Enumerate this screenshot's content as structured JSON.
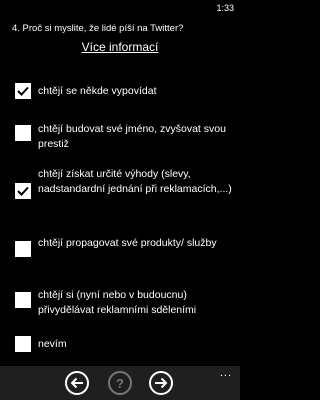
{
  "status": {
    "time": "1:33"
  },
  "question": {
    "text": "4.  Proč si myslite, že lidé píší na Twitter?",
    "more_info": "Více informací"
  },
  "options": [
    {
      "label": "chtějí se někde vypovídat",
      "checked": true
    },
    {
      "label": "chtějí budovat své jméno, zvyšovat svou prestiž",
      "checked": false
    },
    {
      "label": "chtějí získat určité výhody (slevy, nadstandardní jednání při reklamacích,...)",
      "checked": true
    },
    {
      "label": "chtějí propagovat své produkty/ služby",
      "checked": false
    },
    {
      "label": "chtějí si (nyní nebo v budoucnu) přivydělávat reklamními sděleními",
      "checked": false
    },
    {
      "label": "nevím",
      "checked": false
    }
  ],
  "app_bar": {
    "back_icon": "arrow-left-icon",
    "help_icon": "question-icon",
    "help_glyph": "?",
    "help_enabled": false,
    "forward_icon": "arrow-right-icon",
    "more_label": "..."
  },
  "colors": {
    "background": "#000000",
    "foreground": "#ffffff",
    "checkbox_fill": "#ffffff",
    "check_mark": "#000000",
    "app_bar": "#1f1f1f",
    "disabled": "#777777"
  }
}
